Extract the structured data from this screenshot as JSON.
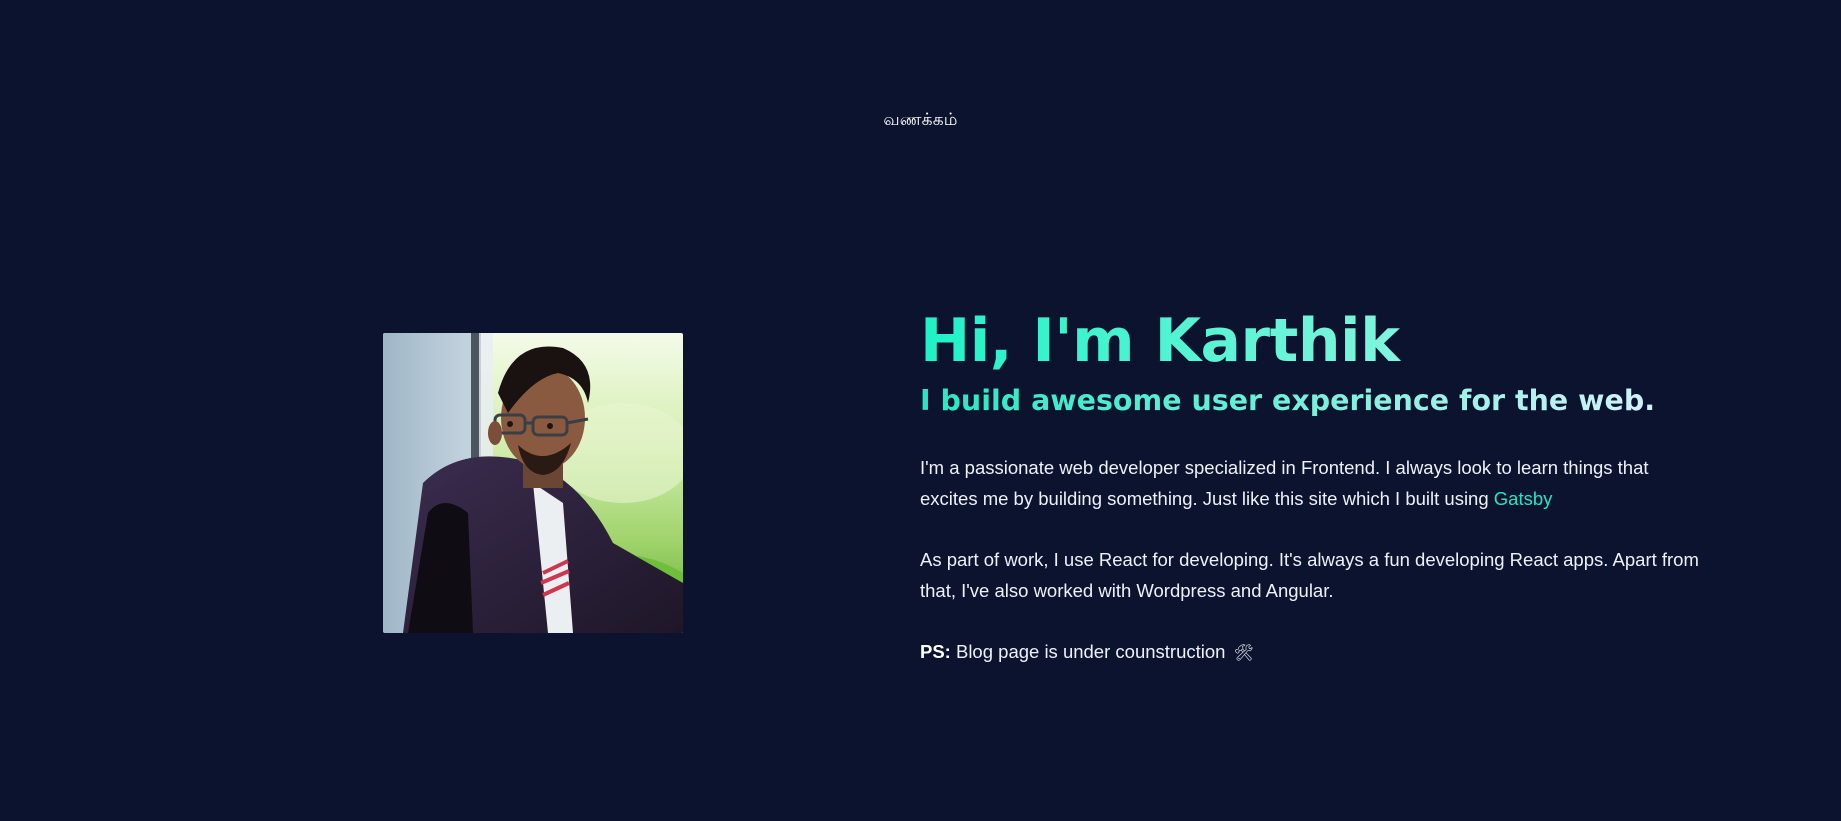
{
  "header": {
    "greeting": "வணக்கம்"
  },
  "profile": {
    "photo_icon": "profile-photo"
  },
  "hero": {
    "title": "Hi, I'm Karthik",
    "subtitle": "I build awesome user experience for the web."
  },
  "about": {
    "para1_text": "I'm a passionate web developer specialized in Frontend. I always look to learn things that excites me by building something. Just like this site which I built using ",
    "para1_link": "Gatsby",
    "para2_text": "As part of work, I use React for developing. It's always a fun developing React apps. Apart from that, I've also worked with Wordpress and Angular.",
    "ps_label": "PS:",
    "ps_text": " Blog page is under counstruction ",
    "ps_icon": "🛠"
  },
  "colors": {
    "background": "#0c132f",
    "accent": "#27e3c4",
    "text": "#eef1f8"
  }
}
